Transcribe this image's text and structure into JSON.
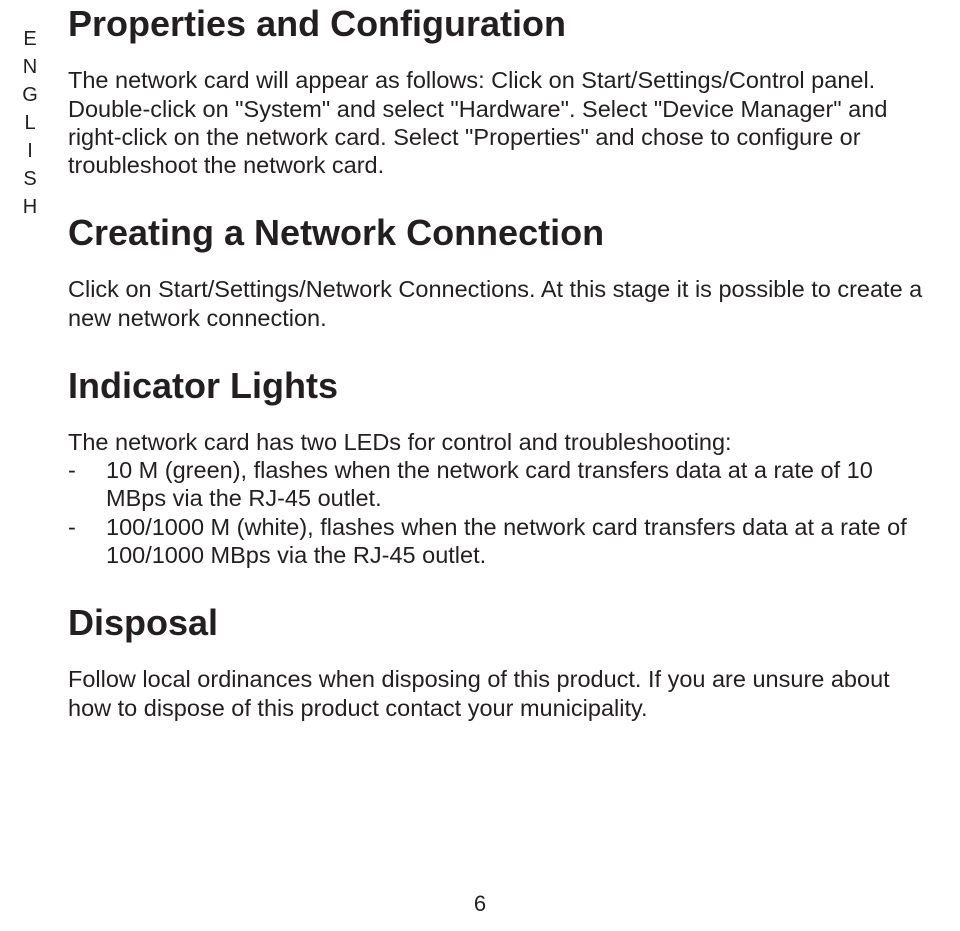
{
  "sideLabel": "ENGLISH",
  "sections": {
    "s1": {
      "heading": "Properties and Configuration",
      "body": "The network card will appear as follows: Click on Start/Settings/Control panel. Double-click on \"System\" and select \"Hardware\". Select \"Device Manager\" and right-click on the network card. Select \"Properties\" and chose to configure or troubleshoot the network card."
    },
    "s2": {
      "heading": "Creating a Network Connection",
      "body": "Click on Start/Settings/Network Connections. At this stage it is possible to create a new network connection."
    },
    "s3": {
      "heading": "Indicator Lights",
      "intro": "The network card has two LEDs for control and troubleshooting:",
      "items": [
        "10 M (green), flashes when the network card transfers data at a rate of 10 MBps via the RJ-45 outlet.",
        "100/1000 M (white), flashes when the network card transfers data at a rate of 100/1000 MBps via the RJ-45 outlet."
      ]
    },
    "s4": {
      "heading": "Disposal",
      "body": "Follow local ordinances when disposing of this product. If you are unsure about how to dispose of this product contact your municipality."
    }
  },
  "dash": "-",
  "pageNumber": "6"
}
